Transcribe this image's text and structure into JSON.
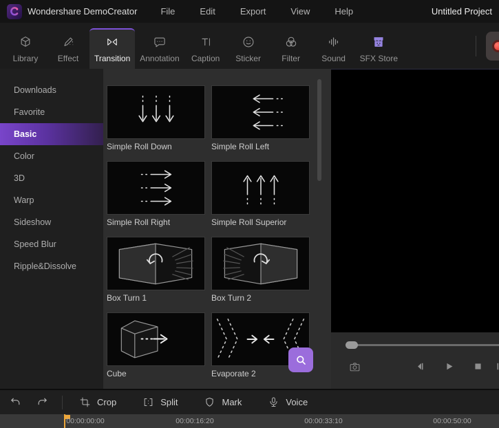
{
  "titlebar": {
    "app_name": "Wondershare DemoCreator",
    "menus": [
      {
        "label": "File"
      },
      {
        "label": "Edit"
      },
      {
        "label": "Export"
      },
      {
        "label": "View"
      },
      {
        "label": "Help"
      }
    ],
    "project_name": "Untitled Project"
  },
  "tab_bar": {
    "tabs": [
      {
        "label": "Library",
        "icon": "library-cube-icon",
        "selected": false
      },
      {
        "label": "Effect",
        "icon": "effect-pen-icon",
        "selected": false
      },
      {
        "label": "Transition",
        "icon": "transition-bowtie-icon",
        "selected": true
      },
      {
        "label": "Annotation",
        "icon": "annotation-bubble-icon",
        "selected": false
      },
      {
        "label": "Caption",
        "icon": "caption-text-icon",
        "selected": false
      },
      {
        "label": "Sticker",
        "icon": "sticker-smiley-icon",
        "selected": false
      },
      {
        "label": "Filter",
        "icon": "filter-circles-icon",
        "selected": false
      },
      {
        "label": "Sound",
        "icon": "sound-wave-icon",
        "selected": false
      },
      {
        "label": "SFX Store",
        "icon": "sfx-store-icon",
        "selected": false
      }
    ]
  },
  "sidebar": {
    "items": [
      {
        "label": "Downloads",
        "selected": false
      },
      {
        "label": "Favorite",
        "selected": false
      },
      {
        "label": "Basic",
        "selected": true
      },
      {
        "label": "Color",
        "selected": false
      },
      {
        "label": "3D",
        "selected": false
      },
      {
        "label": "Warp",
        "selected": false
      },
      {
        "label": "Sideshow",
        "selected": false
      },
      {
        "label": "Speed Blur",
        "selected": false
      },
      {
        "label": "Ripple&Dissolve",
        "selected": false
      }
    ]
  },
  "transitions": {
    "items": [
      {
        "name": "Simple Roll Down",
        "icon": "arrows-down"
      },
      {
        "name": "Simple Roll Left",
        "icon": "arrows-left"
      },
      {
        "name": "Simple Roll Right",
        "icon": "arrows-right"
      },
      {
        "name": "Simple Roll Superior",
        "icon": "arrows-up"
      },
      {
        "name": "Box Turn 1",
        "icon": "box-turn-1"
      },
      {
        "name": "Box Turn 2",
        "icon": "box-turn-2"
      },
      {
        "name": "Cube",
        "icon": "cube-3d"
      },
      {
        "name": "Evaporate 2",
        "icon": "evaporate"
      }
    ]
  },
  "preview": {
    "controls": [
      "snapshot-camera-icon",
      "previous-frame-icon",
      "play-icon",
      "stop-icon",
      "next-frame-icon"
    ]
  },
  "editor_toolbar": {
    "buttons": [
      {
        "label": "Crop",
        "icon": "crop-icon"
      },
      {
        "label": "Split",
        "icon": "split-icon"
      },
      {
        "label": "Mark",
        "icon": "mark-icon"
      },
      {
        "label": "Voice",
        "icon": "voice-icon"
      }
    ]
  },
  "timeline": {
    "timestamps": [
      "00:00:00:00",
      "00:00:16:20",
      "00:00:33:10",
      "00:00:50:00"
    ]
  },
  "colors": {
    "accent_purple": "#7d52d8",
    "sidebar_selected_purple": "#7945ca",
    "sfx_store_purple": "#9583e0",
    "search_button_purple": "#9b6ddc",
    "record_red": "#da2d24",
    "playhead_yellow": "#eda73b"
  }
}
